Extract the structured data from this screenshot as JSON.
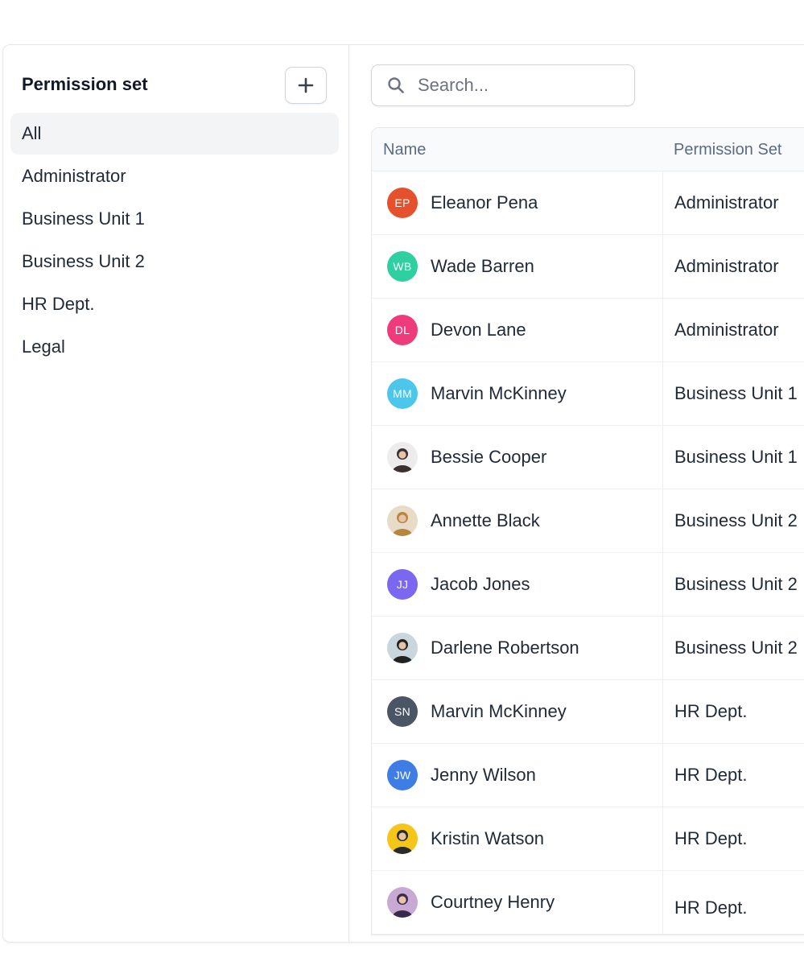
{
  "sidebar": {
    "title": "Permission set",
    "add_icon": "plus-icon",
    "items": [
      {
        "label": "All",
        "active": true
      },
      {
        "label": "Administrator"
      },
      {
        "label": "Business Unit 1"
      },
      {
        "label": "Business Unit 2"
      },
      {
        "label": "HR Dept."
      },
      {
        "label": "Legal"
      }
    ]
  },
  "search": {
    "placeholder": "Search...",
    "value": "",
    "icon": "search-icon"
  },
  "table": {
    "columns": [
      "Name",
      "Permission Set"
    ],
    "rows": [
      {
        "initials": "EP",
        "name": "Eleanor Pena",
        "permission": "Administrator",
        "color": "#e5512d"
      },
      {
        "initials": "WB",
        "name": "Wade Barren",
        "permission": "Administrator",
        "color": "#2ecfa1"
      },
      {
        "initials": "DL",
        "name": "Devon Lane",
        "permission": "Administrator",
        "color": "#ef3a7b"
      },
      {
        "initials": "MM",
        "name": "Marvin McKinney",
        "permission": "Business Unit 1",
        "color": "#4cc6ea"
      },
      {
        "photo": true,
        "name": "Bessie Cooper",
        "permission": "Business Unit 1",
        "color": "#3b2f2f",
        "bg": "#ececec"
      },
      {
        "photo": true,
        "name": "Annette Black",
        "permission": "Business Unit 2",
        "color": "#b7863e",
        "bg": "#e8dcc8"
      },
      {
        "initials": "JJ",
        "name": "Jacob Jones",
        "permission": "Business Unit 2",
        "color": "#7b68f0"
      },
      {
        "photo": true,
        "name": "Darlene Robertson",
        "permission": "Business Unit 2",
        "color": "#222222",
        "bg": "#c9d6dd"
      },
      {
        "initials": "SN",
        "name": "Marvin McKinney",
        "permission": "HR Dept.",
        "color": "#4a5566"
      },
      {
        "initials": "JW",
        "name": "Jenny Wilson",
        "permission": "HR Dept.",
        "color": "#3e7de6"
      },
      {
        "photo": true,
        "name": "Kristin Watson",
        "permission": "HR Dept.",
        "color": "#2a2a2a",
        "bg": "#f5c518"
      },
      {
        "photo": true,
        "name": "Courtney Henry",
        "permission": "HR Dept.",
        "color": "#3a2a4a",
        "bg": "#c8a9d4"
      }
    ]
  }
}
